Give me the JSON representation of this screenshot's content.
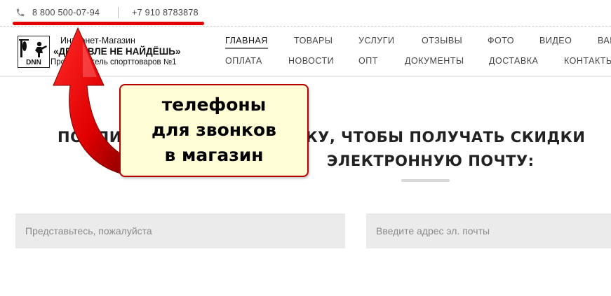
{
  "topbar": {
    "phone1": "8 800 500-07-94",
    "phone2": "+7 910 8783878"
  },
  "logo": {
    "line1": "Интернет-Магазин",
    "line2": "«ДЕШЕВЛЕ НЕ НАЙДЁШЬ»",
    "line3": "Производитель спорттоваров №1",
    "mark": "DNN"
  },
  "nav": {
    "row1": [
      "ГЛАВНАЯ",
      "ТОВАРЫ",
      "УСЛУГИ",
      "ОТЗЫВЫ",
      "ФОТО",
      "ВИДЕО",
      "ВАКА"
    ],
    "row2": [
      "ОПЛАТА",
      "НОВОСТИ",
      "ОПТ",
      "ДОКУМЕНТЫ",
      "ДОСТАВКА",
      "КОНТАКТЫ"
    ]
  },
  "subscribe": {
    "line1": "ПОДПИШИТЕСЬ НА РАССЫЛКУ, ЧТОБЫ ПОЛУЧАТЬ СКИДКИ",
    "line2": "ЭЛЕКТРОННУЮ ПОЧТУ:",
    "name_placeholder": "Представьтесь, пожалуйста",
    "email_placeholder": "Введите адрес эл. почты"
  },
  "callout": {
    "line1": "телефоны",
    "line2": "для звонков",
    "line3": "в магазин"
  },
  "colors": {
    "accent_red": "#e20000",
    "callout_bg": "#fffdd6"
  }
}
